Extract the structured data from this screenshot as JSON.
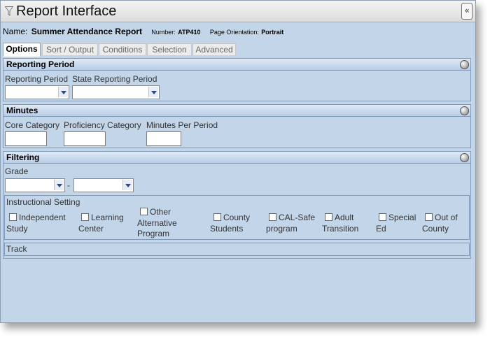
{
  "window": {
    "title": "Report Interface",
    "collapse_label": "«"
  },
  "report": {
    "name_label": "Name:",
    "name": "Summer Attendance Report",
    "number_label": "Number:",
    "number": "ATP410",
    "orientation_label": "Page Orientation:",
    "orientation": "Portrait"
  },
  "tabs": [
    "Options",
    "Sort / Output",
    "Conditions",
    "Selection",
    "Advanced"
  ],
  "sections": {
    "reporting": {
      "title": "Reporting Period",
      "field1_label": "Reporting Period",
      "field2_label": "State Reporting Period"
    },
    "minutes": {
      "title": "Minutes",
      "field1_label": "Core Category",
      "field2_label": "Proficiency Category",
      "field3_label": "Minutes Per Period"
    },
    "filtering": {
      "title": "Filtering",
      "grade_label": "Grade",
      "range_separator": "-",
      "instructional_setting": {
        "title": "Instructional Setting",
        "options": [
          {
            "line1": "Independent",
            "line2": "Study",
            "line3": ""
          },
          {
            "line1": "Learning",
            "line2": "Center",
            "line3": ""
          },
          {
            "line1": "Other",
            "line2": "Alternative",
            "line3": "Program"
          },
          {
            "line1": "County",
            "line2": "Students",
            "line3": ""
          },
          {
            "line1": "CAL-Safe",
            "line2": "program",
            "line3": ""
          },
          {
            "line1": "Adult",
            "line2": "Transition",
            "line3": ""
          },
          {
            "line1": "Special",
            "line2": "Ed",
            "line3": ""
          },
          {
            "line1": "Out of",
            "line2": "County",
            "line3": ""
          }
        ]
      },
      "track_label": "Track"
    }
  }
}
